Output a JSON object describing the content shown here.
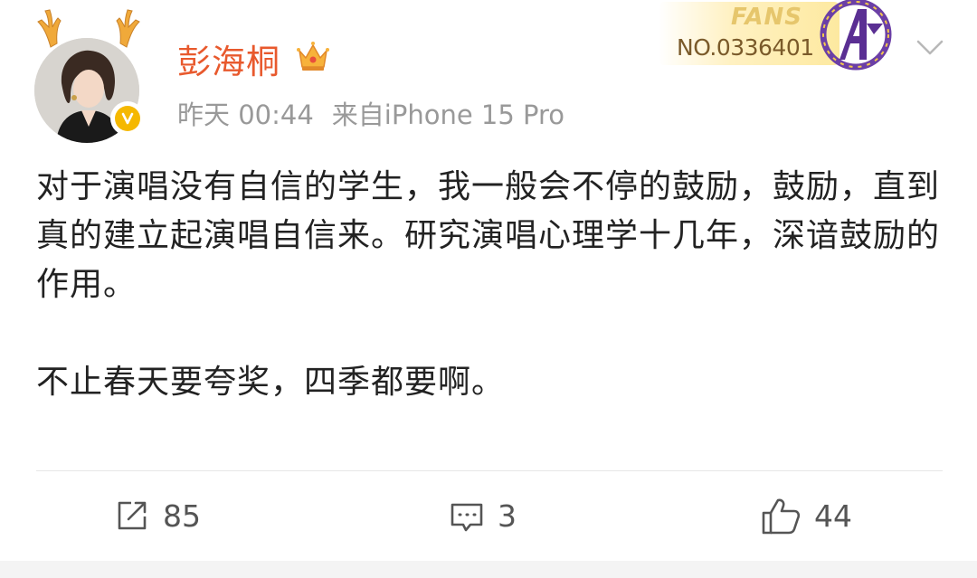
{
  "post": {
    "author": {
      "name": "彭海桐",
      "avatar_icon": "avatar-photo",
      "verified_icon": "verified-badge-icon",
      "verified_color": "#f5b800",
      "member_icon": "crown-icon",
      "name_color": "#e8592d"
    },
    "meta": {
      "time": "昨天 00:44",
      "source": "来自iPhone 15 Pro"
    },
    "fans_badge": {
      "label": "FANS",
      "number": "NO.0336401",
      "logo_icon": "avengers-logo-icon"
    },
    "menu_icon": "chevron-down-icon",
    "content": {
      "paragraph_1": "对于演唱没有自信的学生，我一般会不停的鼓励，鼓励，直到真的建立起演唱自信来。研究演唱心理学十几年，深谙鼓励的作用。",
      "paragraph_2": "不止春天要夸奖，四季都要啊。"
    },
    "actions": {
      "repost": {
        "icon": "repost-icon",
        "count": "85"
      },
      "comment": {
        "icon": "comment-icon",
        "count": "3"
      },
      "like": {
        "icon": "thumbs-up-icon",
        "count": "44"
      }
    }
  }
}
